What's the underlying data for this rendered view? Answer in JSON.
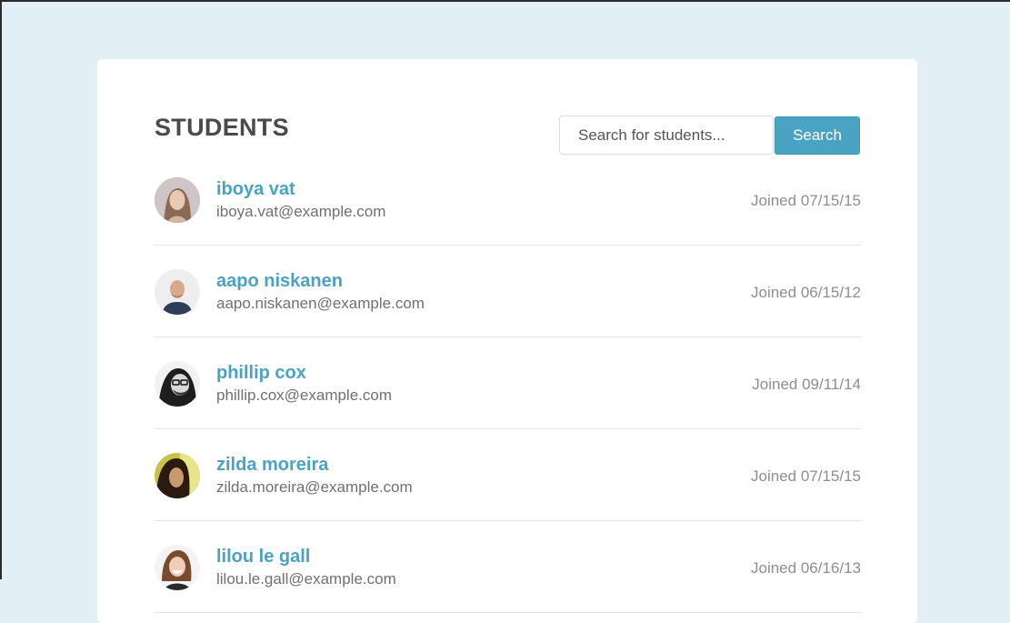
{
  "page": {
    "title": "STUDENTS"
  },
  "search": {
    "placeholder": "Search for students...",
    "button_label": "Search"
  },
  "students": [
    {
      "name": "iboya vat",
      "email": "iboya.vat@example.com",
      "joined": "Joined 07/15/15"
    },
    {
      "name": "aapo niskanen",
      "email": "aapo.niskanen@example.com",
      "joined": "Joined 06/15/12"
    },
    {
      "name": "phillip cox",
      "email": "phillip.cox@example.com",
      "joined": "Joined 09/11/14"
    },
    {
      "name": "zilda moreira",
      "email": "zilda.moreira@example.com",
      "joined": "Joined 07/15/15"
    },
    {
      "name": "lilou le gall",
      "email": "lilou.le.gall@example.com",
      "joined": "Joined 06/16/13"
    }
  ],
  "colors": {
    "background": "#e2f0f5",
    "accent": "#4aa3c3",
    "card": "#ffffff"
  }
}
